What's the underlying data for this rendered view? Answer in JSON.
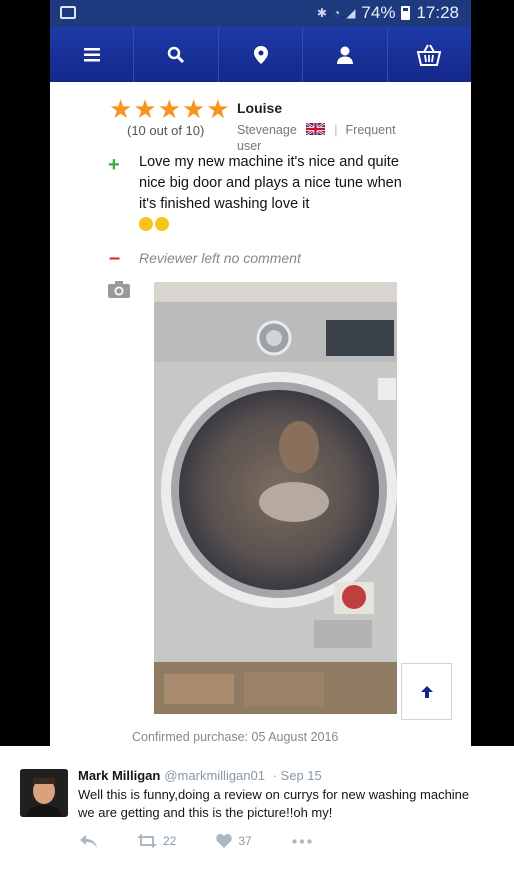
{
  "status_bar": {
    "battery_percent": "74%",
    "time": "17:28"
  },
  "nav": {
    "items": [
      "menu-icon",
      "search-icon",
      "location-pin-icon",
      "account-icon",
      "basket-icon"
    ]
  },
  "review": {
    "rating_stars": 5,
    "score_text": "(10 out of 10)",
    "reviewer_name": "Louise",
    "location": "Stevenage",
    "reviewer_type": "Frequent user",
    "pro_text": "Love my new machine it's nice and quite nice big door and plays a nice tune when it's finished washing love it",
    "con_text": "Reviewer left no comment",
    "confirmed_purchase": "Confirmed purchase: 05 August 2016"
  },
  "tweet": {
    "name": "Mark Milligan",
    "handle": "@markmilligan01",
    "date": "· Sep 15",
    "text": "Well this is funny,doing a review on currys for new washing machine we are getting and this is the picture!!oh my!",
    "retweets": "22",
    "likes": "37"
  },
  "colors": {
    "status_bar": "#1d3a7e",
    "nav_bar": "#1a33a0",
    "star": "#f7941d",
    "plus": "#3dab3d",
    "minus": "#e2231a"
  }
}
